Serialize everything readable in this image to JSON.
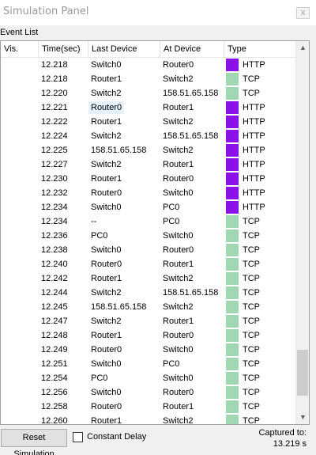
{
  "window": {
    "title": "Simulation Panel",
    "close_glyph": "x"
  },
  "event_list": {
    "group_label": "Event List",
    "columns": [
      "Vis.",
      "Time(sec)",
      "Last Device",
      "At Device",
      "Type"
    ],
    "rows": [
      {
        "time": "12.218",
        "last": "Switch0",
        "at": "Router0",
        "type": "HTTP"
      },
      {
        "time": "12.218",
        "last": "Router1",
        "at": "Switch2",
        "type": "TCP"
      },
      {
        "time": "12.220",
        "last": "Switch2",
        "at": "158.51.65.158",
        "type": "TCP"
      },
      {
        "time": "12.221",
        "last": "Router0",
        "at": "Router1",
        "type": "HTTP"
      },
      {
        "time": "12.222",
        "last": "Router1",
        "at": "Switch2",
        "type": "HTTP"
      },
      {
        "time": "12.224",
        "last": "Switch2",
        "at": "158.51.65.158",
        "type": "HTTP"
      },
      {
        "time": "12.225",
        "last": "158.51.65.158",
        "at": "Switch2",
        "type": "HTTP"
      },
      {
        "time": "12.227",
        "last": "Switch2",
        "at": "Router1",
        "type": "HTTP"
      },
      {
        "time": "12.230",
        "last": "Router1",
        "at": "Router0",
        "type": "HTTP"
      },
      {
        "time": "12.232",
        "last": "Router0",
        "at": "Switch0",
        "type": "HTTP"
      },
      {
        "time": "12.234",
        "last": "Switch0",
        "at": "PC0",
        "type": "HTTP"
      },
      {
        "time": "12.234",
        "last": "--",
        "at": "PC0",
        "type": "TCP"
      },
      {
        "time": "12.236",
        "last": "PC0",
        "at": "Switch0",
        "type": "TCP"
      },
      {
        "time": "12.238",
        "last": "Switch0",
        "at": "Router0",
        "type": "TCP"
      },
      {
        "time": "12.240",
        "last": "Router0",
        "at": "Router1",
        "type": "TCP"
      },
      {
        "time": "12.242",
        "last": "Router1",
        "at": "Switch2",
        "type": "TCP"
      },
      {
        "time": "12.244",
        "last": "Switch2",
        "at": "158.51.65.158",
        "type": "TCP"
      },
      {
        "time": "12.245",
        "last": "158.51.65.158",
        "at": "Switch2",
        "type": "TCP"
      },
      {
        "time": "12.247",
        "last": "Switch2",
        "at": "Router1",
        "type": "TCP"
      },
      {
        "time": "12.248",
        "last": "Router1",
        "at": "Router0",
        "type": "TCP"
      },
      {
        "time": "12.249",
        "last": "Router0",
        "at": "Switch0",
        "type": "TCP"
      },
      {
        "time": "12.251",
        "last": "Switch0",
        "at": "PC0",
        "type": "TCP"
      },
      {
        "time": "12.254",
        "last": "PC0",
        "at": "Switch0",
        "type": "TCP"
      },
      {
        "time": "12.256",
        "last": "Switch0",
        "at": "Router0",
        "type": "TCP"
      },
      {
        "time": "12.258",
        "last": "Router0",
        "at": "Router1",
        "type": "TCP"
      },
      {
        "time": "12.260",
        "last": "Router1",
        "at": "Switch2",
        "type": "TCP"
      }
    ],
    "type_colors": {
      "HTTP": "#8a12e8",
      "TCP": "#9fd8b1"
    },
    "highlight_color": "#e5f1fb"
  },
  "footer": {
    "reset_label": "Reset Simulation",
    "constant_delay_label": "Constant Delay",
    "constant_delay_checked": false,
    "captured_label": "Captured to:",
    "captured_value": "13.219 s"
  },
  "icons": {
    "scroll_up": "scroll-up-arrow",
    "scroll_down": "scroll-down-arrow",
    "close": "close-icon"
  }
}
